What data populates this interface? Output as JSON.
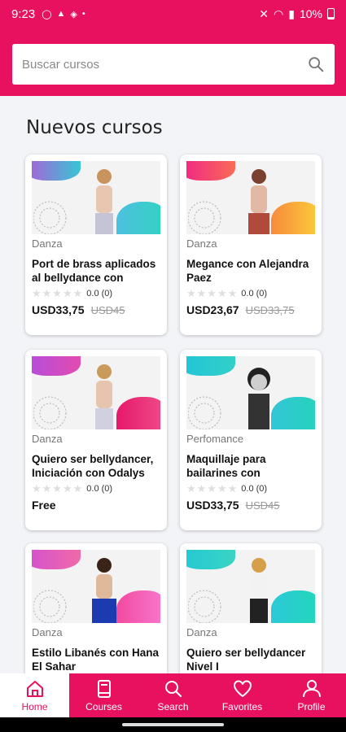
{
  "status_bar": {
    "time": "9:23",
    "battery": "10%"
  },
  "search": {
    "placeholder": "Buscar cursos"
  },
  "section_title": "Nuevos cursos",
  "courses": [
    {
      "category": "Danza",
      "title": "Port de brass aplicados al bellydance con",
      "rating": "0.0 (0)",
      "price": "USD33,75",
      "old_price": "USD45"
    },
    {
      "category": "Danza",
      "title": "Megance con Alejandra Paez",
      "rating": "0.0 (0)",
      "price": "USD23,67",
      "old_price": "USD33,75"
    },
    {
      "category": "Danza",
      "title": "Quiero ser bellydancer, Iniciación con Odalys",
      "rating": "0.0 (0)",
      "price": "Free",
      "old_price": ""
    },
    {
      "category": "Perfomance",
      "title": "Maquillaje para bailarines con",
      "rating": "0.0 (0)",
      "price": "USD33,75",
      "old_price": "USD45"
    },
    {
      "category": "Danza",
      "title": "Estilo Libanés con Hana El Sahar",
      "rating": "",
      "price": "",
      "old_price": ""
    },
    {
      "category": "Danza",
      "title": "Quiero ser bellydancer Nivel I",
      "rating": "",
      "price": "",
      "old_price": ""
    }
  ],
  "nav": {
    "home": "Home",
    "courses": "Courses",
    "search": "Search",
    "favorites": "Favorites",
    "profile": "Profile"
  },
  "colors": {
    "brand": "#e8115f"
  }
}
